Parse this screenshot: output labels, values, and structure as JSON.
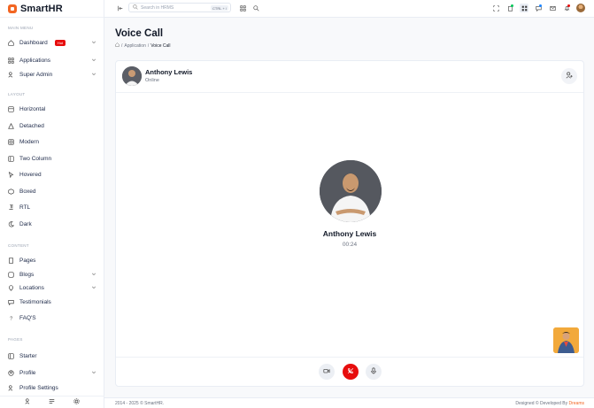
{
  "brand": {
    "name": "SmartHR"
  },
  "sidebar": {
    "sections": [
      {
        "title": "MAIN MENU"
      },
      {
        "title": "LAYOUT"
      },
      {
        "title": "CONTENT"
      },
      {
        "title": "PAGES"
      }
    ],
    "items": [
      {
        "label": "Dashboard",
        "badge": "Hot"
      },
      {
        "label": "Applications"
      },
      {
        "label": "Super Admin"
      },
      {
        "label": "Horizontal"
      },
      {
        "label": "Detached"
      },
      {
        "label": "Modern"
      },
      {
        "label": "Two Column"
      },
      {
        "label": "Hovered"
      },
      {
        "label": "Boxed"
      },
      {
        "label": "RTL"
      },
      {
        "label": "Dark"
      },
      {
        "label": "Pages"
      },
      {
        "label": "Blogs"
      },
      {
        "label": "Locations"
      },
      {
        "label": "Testimonials"
      },
      {
        "label": "FAQ'S"
      },
      {
        "label": "Starter"
      },
      {
        "label": "Profile"
      },
      {
        "label": "Profile Settings"
      }
    ]
  },
  "topbar": {
    "search_placeholder": "Search in HRMS",
    "shortcut": "CTRL + /"
  },
  "page": {
    "title": "Voice Call",
    "breadcrumb": {
      "parent": "Application",
      "separator": "/",
      "current": "Voice Call"
    }
  },
  "call": {
    "contact_name": "Anthony Lewis",
    "contact_status": "Online",
    "caller_name": "Anthony Lewis",
    "duration": "00:24"
  },
  "footer": {
    "copyright": "2014 - 2025 © SmartHR.",
    "credit_prefix": "Designed © Developed By",
    "credit_brand": "Dreams"
  },
  "colors": {
    "accent": "#f26522",
    "danger": "#e70d0d",
    "text": "#202c4b"
  }
}
